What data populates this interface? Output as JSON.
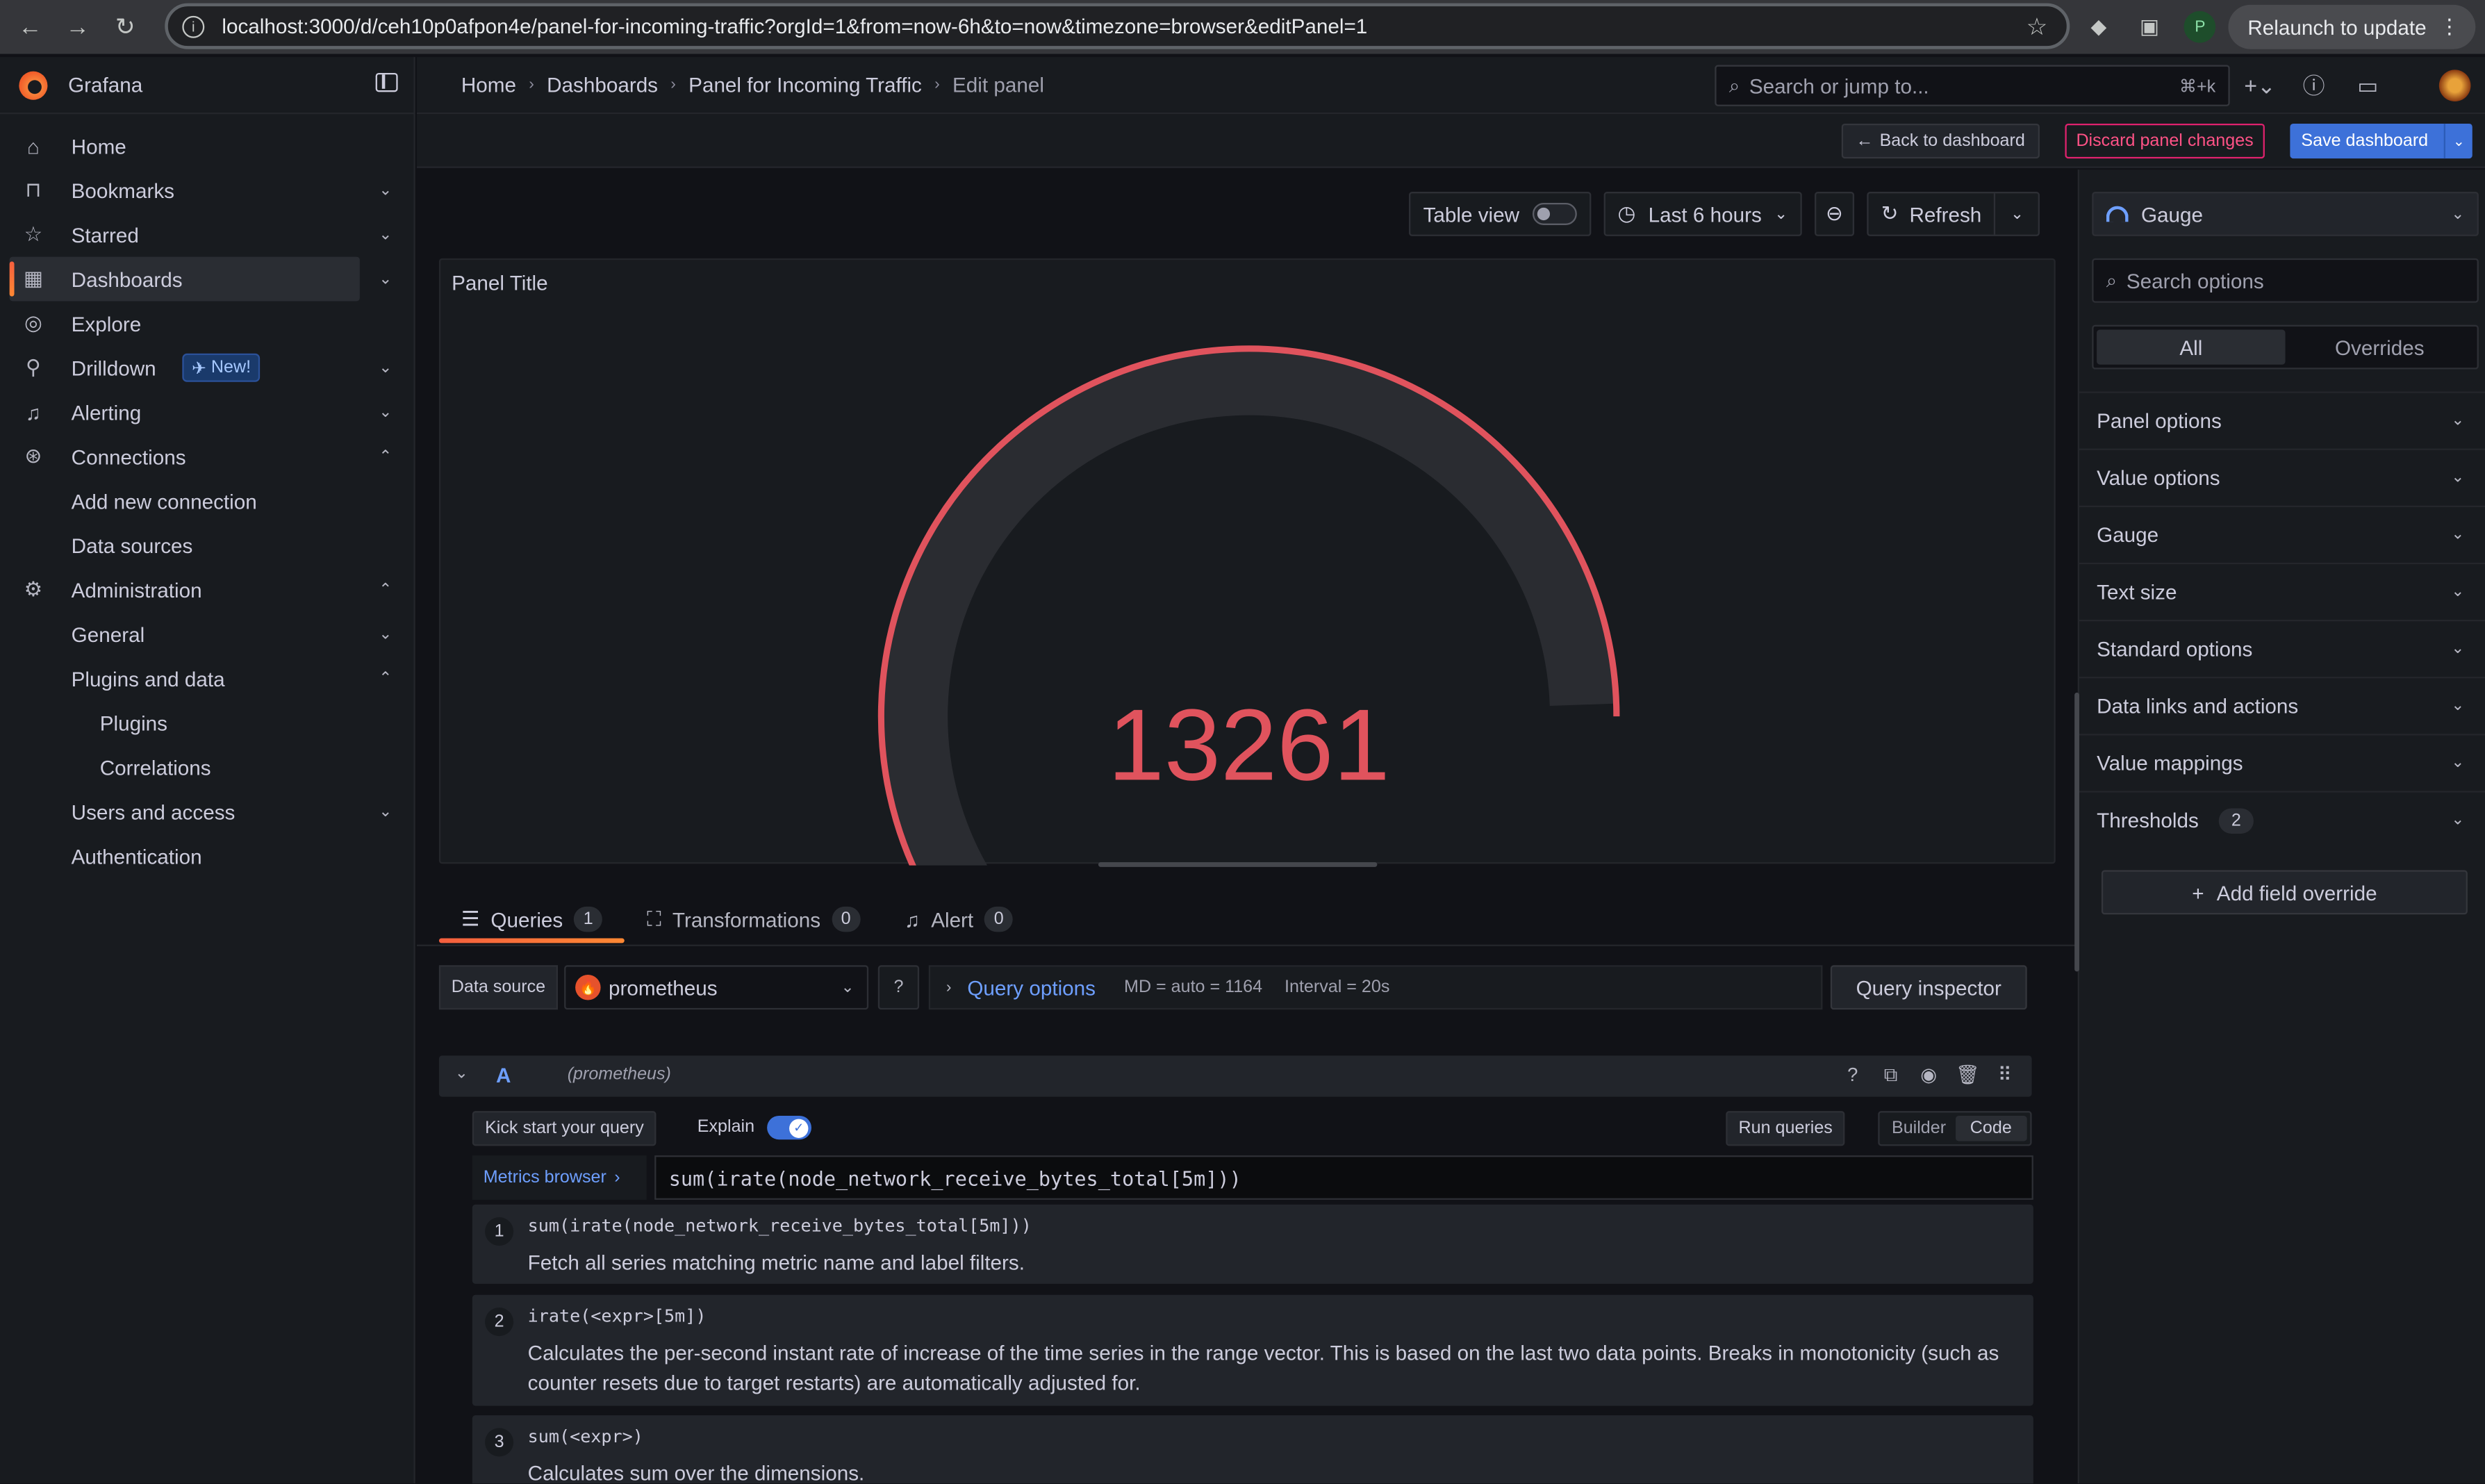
{
  "browser": {
    "url": "localhost:3000/d/ceh10p0afpon4e/panel-for-incoming-traffic?orgId=1&from=now-6h&to=now&timezone=browser&editPanel=1",
    "profile_initial": "P",
    "relaunch_label": "Relaunch to update"
  },
  "sidebar": {
    "app_name": "Grafana",
    "new_badge": "New!",
    "items": [
      {
        "label": "Home",
        "icon": "home-icon"
      },
      {
        "label": "Bookmarks",
        "icon": "bookmark-icon"
      },
      {
        "label": "Starred",
        "icon": "star-icon"
      },
      {
        "label": "Dashboards",
        "icon": "apps-icon",
        "active": true
      },
      {
        "label": "Explore",
        "icon": "compass-icon"
      },
      {
        "label": "Drilldown",
        "icon": "microscope-icon"
      },
      {
        "label": "Alerting",
        "icon": "bell-icon"
      },
      {
        "label": "Connections",
        "icon": "plug-icon"
      },
      {
        "label": "Add new connection"
      },
      {
        "label": "Data sources"
      },
      {
        "label": "Administration",
        "icon": "cog-icon"
      },
      {
        "label": "General"
      },
      {
        "label": "Plugins and data"
      },
      {
        "label": "Plugins"
      },
      {
        "label": "Correlations"
      },
      {
        "label": "Users and access"
      },
      {
        "label": "Authentication"
      }
    ]
  },
  "topbar": {
    "breadcrumbs": [
      "Home",
      "Dashboards",
      "Panel for Incoming Traffic",
      "Edit panel"
    ],
    "search_placeholder": "Search or jump to...",
    "search_shortcut": "⌘+k"
  },
  "actions": {
    "back": "Back to dashboard",
    "discard": "Discard panel changes",
    "save": "Save dashboard"
  },
  "toolbar": {
    "table_view": "Table view",
    "time_range": "Last 6 hours",
    "refresh": "Refresh"
  },
  "panel": {
    "title": "Panel Title",
    "value": "13261",
    "value_color": "#e0535d",
    "gauge_fill_fraction": 1.0
  },
  "tabs": [
    {
      "label": "Queries",
      "count": "1"
    },
    {
      "label": "Transformations",
      "count": "0"
    },
    {
      "label": "Alert",
      "count": "0"
    }
  ],
  "query_bar": {
    "ds_label": "Data source",
    "ds_value": "prometheus",
    "query_options": "Query options",
    "md": "MD = auto = 1164",
    "interval": "Interval = 20s",
    "inspector": "Query inspector"
  },
  "query": {
    "ref": "A",
    "ds": "(prometheus)",
    "kick_start": "Kick start your query",
    "explain": "Explain",
    "run": "Run queries",
    "mode_builder": "Builder",
    "mode_code": "Code",
    "metrics_browser": "Metrics browser",
    "expr": "sum(irate(node_network_receive_bytes_total[5m]))"
  },
  "explain_steps": [
    {
      "n": "1",
      "code": "sum(irate(node_network_receive_bytes_total[5m]))",
      "desc": "Fetch all series matching metric name and label filters."
    },
    {
      "n": "2",
      "code": "irate(<expr>[5m])",
      "desc": "Calculates the per-second instant rate of increase of the time series in the range vector. This is based on the last two data points. Breaks in monotonicity (such as counter resets due to target restarts) are automatically adjusted for."
    },
    {
      "n": "3",
      "code": "sum(<expr>)",
      "desc": "Calculates sum over the dimensions."
    }
  ],
  "options": {
    "viz": "Gauge",
    "search_placeholder": "Search options",
    "seg_all": "All",
    "seg_overrides": "Overrides",
    "sections": [
      "Panel options",
      "Value options",
      "Gauge",
      "Text size",
      "Standard options",
      "Data links and actions",
      "Value mappings",
      "Thresholds"
    ],
    "thresholds_count": "2",
    "add_override": "Add field override"
  }
}
